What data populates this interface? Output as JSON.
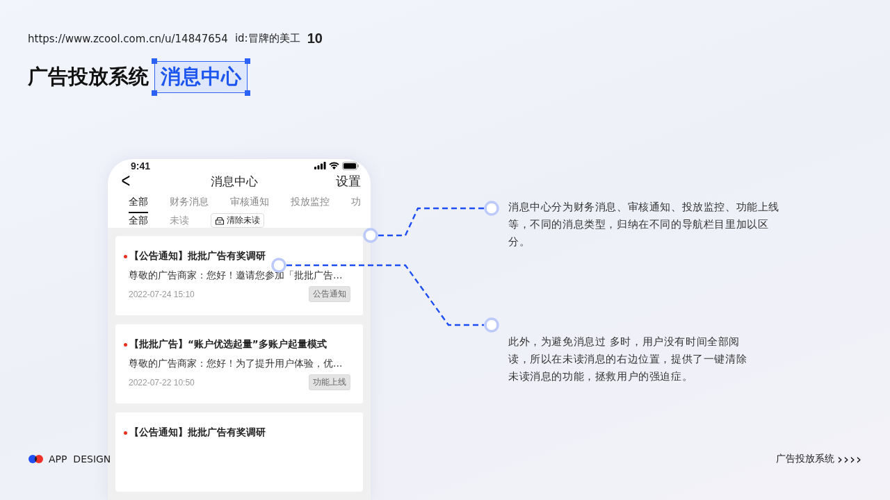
{
  "header": {
    "url": "https://www.zcool.com.cn/u/14847654",
    "author_id": "id:冒牌的美工",
    "page_number": "10",
    "title": "广告投放系统",
    "highlight": "消息中心"
  },
  "phone": {
    "status_time": "9:41",
    "nav": {
      "back": "<",
      "title": "消息中心",
      "action": "设置"
    },
    "tabs": [
      {
        "label": "全部",
        "selected": true
      },
      {
        "label": "财务消息",
        "selected": false
      },
      {
        "label": "审核通知",
        "selected": false
      },
      {
        "label": "投放监控",
        "selected": false
      },
      {
        "label": "功",
        "selected": false
      }
    ],
    "filters": [
      {
        "label": "全部",
        "selected": true
      },
      {
        "label": "未读",
        "selected": false
      }
    ],
    "clear_button": "清除未读",
    "messages": [
      {
        "title": "【公告通知】批批广告有奖调研",
        "preview": "尊敬的广告商家：您好！邀请您参加「批批广告…",
        "time": "2022-07-24 15:10",
        "tag": "公告通知",
        "unread": true
      },
      {
        "title": "【批批广告】“账户优选起量”多账户起量模式",
        "preview": "尊敬的广告商家：您好！为了提升用户体验，优…",
        "time": "2022-07-22 10:50",
        "tag": "功能上线",
        "unread": true
      },
      {
        "title": "【公告通知】批批广告有奖调研",
        "unread": true
      }
    ]
  },
  "annotations": [
    {
      "text": "消息中心分为财务消息、审核通知、投放监控、功能上线等，不同的消息类型，归纳在不同的导航栏目里加以区分。"
    },
    {
      "text": "此外，为避免消息过 多时，用户没有时间全部阅读，所以在未读消息的右边位置，提供了一键清除未读消息的功能，拯救用户的强迫症。"
    }
  ],
  "footer": {
    "brand": "APP  DESIGN",
    "section": "广告投放系统",
    "arrows": "››››"
  }
}
